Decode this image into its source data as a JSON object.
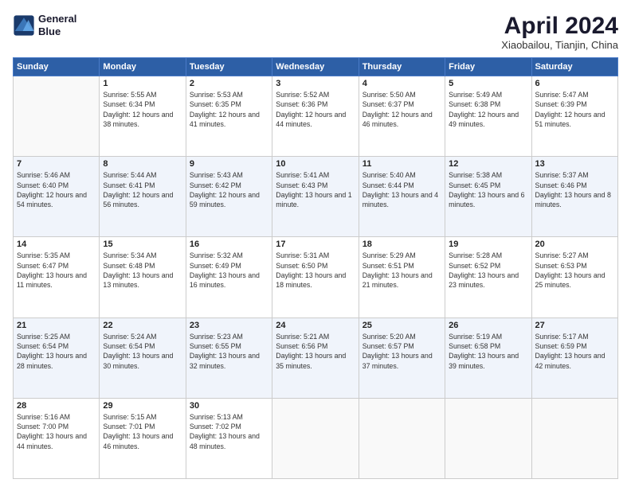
{
  "header": {
    "logo_line1": "General",
    "logo_line2": "Blue",
    "month": "April 2024",
    "location": "Xiaobailou, Tianjin, China"
  },
  "weekdays": [
    "Sunday",
    "Monday",
    "Tuesday",
    "Wednesday",
    "Thursday",
    "Friday",
    "Saturday"
  ],
  "weeks": [
    [
      {
        "day": "",
        "empty": true
      },
      {
        "day": "1",
        "sunrise": "5:55 AM",
        "sunset": "6:34 PM",
        "daylight": "12 hours and 38 minutes."
      },
      {
        "day": "2",
        "sunrise": "5:53 AM",
        "sunset": "6:35 PM",
        "daylight": "12 hours and 41 minutes."
      },
      {
        "day": "3",
        "sunrise": "5:52 AM",
        "sunset": "6:36 PM",
        "daylight": "12 hours and 44 minutes."
      },
      {
        "day": "4",
        "sunrise": "5:50 AM",
        "sunset": "6:37 PM",
        "daylight": "12 hours and 46 minutes."
      },
      {
        "day": "5",
        "sunrise": "5:49 AM",
        "sunset": "6:38 PM",
        "daylight": "12 hours and 49 minutes."
      },
      {
        "day": "6",
        "sunrise": "5:47 AM",
        "sunset": "6:39 PM",
        "daylight": "12 hours and 51 minutes."
      }
    ],
    [
      {
        "day": "7",
        "sunrise": "5:46 AM",
        "sunset": "6:40 PM",
        "daylight": "12 hours and 54 minutes."
      },
      {
        "day": "8",
        "sunrise": "5:44 AM",
        "sunset": "6:41 PM",
        "daylight": "12 hours and 56 minutes."
      },
      {
        "day": "9",
        "sunrise": "5:43 AM",
        "sunset": "6:42 PM",
        "daylight": "12 hours and 59 minutes."
      },
      {
        "day": "10",
        "sunrise": "5:41 AM",
        "sunset": "6:43 PM",
        "daylight": "13 hours and 1 minute."
      },
      {
        "day": "11",
        "sunrise": "5:40 AM",
        "sunset": "6:44 PM",
        "daylight": "13 hours and 4 minutes."
      },
      {
        "day": "12",
        "sunrise": "5:38 AM",
        "sunset": "6:45 PM",
        "daylight": "13 hours and 6 minutes."
      },
      {
        "day": "13",
        "sunrise": "5:37 AM",
        "sunset": "6:46 PM",
        "daylight": "13 hours and 8 minutes."
      }
    ],
    [
      {
        "day": "14",
        "sunrise": "5:35 AM",
        "sunset": "6:47 PM",
        "daylight": "13 hours and 11 minutes."
      },
      {
        "day": "15",
        "sunrise": "5:34 AM",
        "sunset": "6:48 PM",
        "daylight": "13 hours and 13 minutes."
      },
      {
        "day": "16",
        "sunrise": "5:32 AM",
        "sunset": "6:49 PM",
        "daylight": "13 hours and 16 minutes."
      },
      {
        "day": "17",
        "sunrise": "5:31 AM",
        "sunset": "6:50 PM",
        "daylight": "13 hours and 18 minutes."
      },
      {
        "day": "18",
        "sunrise": "5:29 AM",
        "sunset": "6:51 PM",
        "daylight": "13 hours and 21 minutes."
      },
      {
        "day": "19",
        "sunrise": "5:28 AM",
        "sunset": "6:52 PM",
        "daylight": "13 hours and 23 minutes."
      },
      {
        "day": "20",
        "sunrise": "5:27 AM",
        "sunset": "6:53 PM",
        "daylight": "13 hours and 25 minutes."
      }
    ],
    [
      {
        "day": "21",
        "sunrise": "5:25 AM",
        "sunset": "6:54 PM",
        "daylight": "13 hours and 28 minutes."
      },
      {
        "day": "22",
        "sunrise": "5:24 AM",
        "sunset": "6:54 PM",
        "daylight": "13 hours and 30 minutes."
      },
      {
        "day": "23",
        "sunrise": "5:23 AM",
        "sunset": "6:55 PM",
        "daylight": "13 hours and 32 minutes."
      },
      {
        "day": "24",
        "sunrise": "5:21 AM",
        "sunset": "6:56 PM",
        "daylight": "13 hours and 35 minutes."
      },
      {
        "day": "25",
        "sunrise": "5:20 AM",
        "sunset": "6:57 PM",
        "daylight": "13 hours and 37 minutes."
      },
      {
        "day": "26",
        "sunrise": "5:19 AM",
        "sunset": "6:58 PM",
        "daylight": "13 hours and 39 minutes."
      },
      {
        "day": "27",
        "sunrise": "5:17 AM",
        "sunset": "6:59 PM",
        "daylight": "13 hours and 42 minutes."
      }
    ],
    [
      {
        "day": "28",
        "sunrise": "5:16 AM",
        "sunset": "7:00 PM",
        "daylight": "13 hours and 44 minutes."
      },
      {
        "day": "29",
        "sunrise": "5:15 AM",
        "sunset": "7:01 PM",
        "daylight": "13 hours and 46 minutes."
      },
      {
        "day": "30",
        "sunrise": "5:13 AM",
        "sunset": "7:02 PM",
        "daylight": "13 hours and 48 minutes."
      },
      {
        "day": "",
        "empty": true
      },
      {
        "day": "",
        "empty": true
      },
      {
        "day": "",
        "empty": true
      },
      {
        "day": "",
        "empty": true
      }
    ]
  ]
}
